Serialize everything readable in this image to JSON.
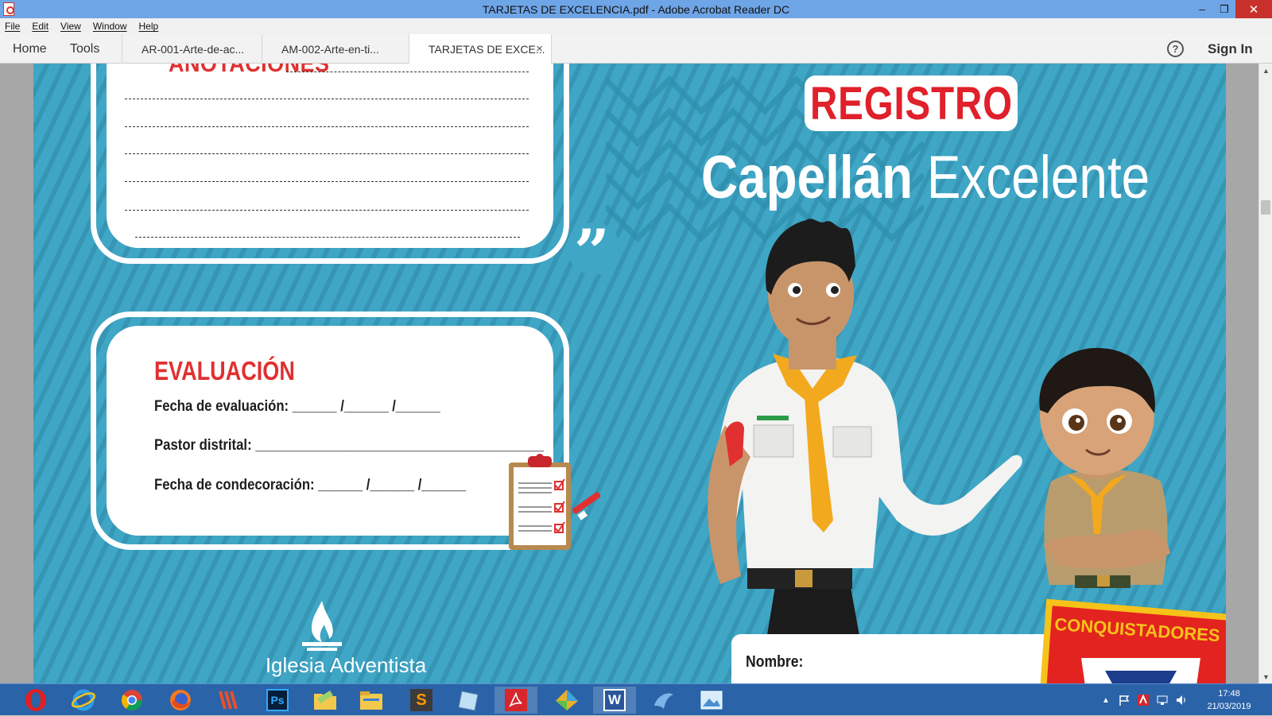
{
  "window": {
    "title": "TARJETAS DE EXCELENCIA.pdf - Adobe Acrobat Reader DC",
    "minimize": "–",
    "restore": "❐",
    "close": "✕"
  },
  "menu": [
    "File",
    "Edit",
    "View",
    "Window",
    "Help"
  ],
  "toolbar": {
    "home": "Home",
    "tools": "Tools",
    "tabs": [
      {
        "label": "AR-001-Arte-de-ac..."
      },
      {
        "label": "AM-002-Arte-en-ti..."
      },
      {
        "label": "TARJETAS DE EXCE...",
        "close": "×"
      }
    ],
    "help": "?",
    "sign_in": "Sign In"
  },
  "document": {
    "anotaciones_title": "ANOTACIONES",
    "quote": "”",
    "evaluacion_title": "EVALUACIÓN",
    "fecha_evaluacion": "Fecha de evaluación: ______ /______ /______",
    "pastor_distrital": "Pastor distrital: _______________________________________",
    "fecha_condecoracion": "Fecha de condecoración: ______ /______ /______",
    "registro": "REGISTRO",
    "capellan_bold": "Capellán",
    "capellan_light": " Excelente",
    "iglesia": "Iglesia Adventista",
    "nombre": "Nombre:",
    "conquistadores": "CONQUISTADORES"
  },
  "taskbar": {
    "apps": [
      "opera-icon",
      "internet-explorer-icon",
      "chrome-icon",
      "firefox-icon",
      "app-icon",
      "photoshop-icon",
      "folder-icon",
      "file-explorer-icon",
      "sublime-icon",
      "notes-icon",
      "acrobat-icon",
      "paint-icon",
      "word-icon",
      "app-icon",
      "photos-icon"
    ],
    "photoshop": "Ps",
    "sublime": "S",
    "word": "W",
    "time": "17:48",
    "date": "21/03/2019"
  },
  "colors": {
    "page_blue": "#3fa6c5",
    "accent_red": "#e0202a",
    "taskbar": "#2b63a8",
    "titlebar": "#6ea5e7"
  }
}
